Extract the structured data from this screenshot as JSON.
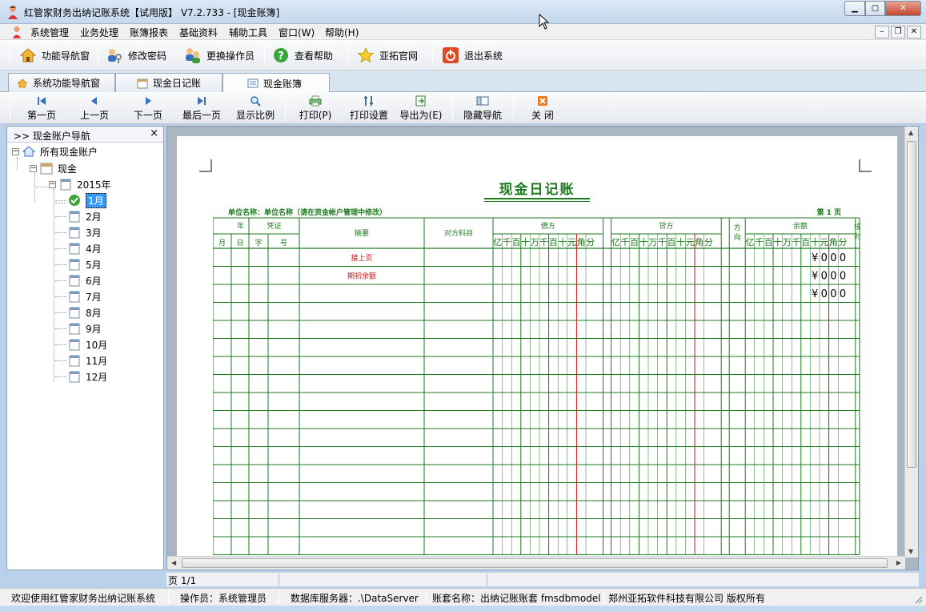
{
  "window": {
    "title": "红管家财务出纳记账系统【试用版】 V7.2.733 - [现金账簿]"
  },
  "menu": [
    "系统管理",
    "业务处理",
    "账簿报表",
    "基础资料",
    "辅助工具",
    "窗口(W)",
    "帮助(H)"
  ],
  "toolbar": {
    "nav": "功能导航窗",
    "password": "修改密码",
    "switch_user": "更换操作员",
    "help": "查看帮助",
    "website": "亚拓官网",
    "exit": "退出系统"
  },
  "tabs": [
    "系统功能导航窗",
    "现金日记账",
    "现金账簿"
  ],
  "report_toolbar": {
    "first": "第一页",
    "prev": "上一页",
    "next": "下一页",
    "last": "最后一页",
    "zoom": "显示比例",
    "print": "打印(P)",
    "print_setup": "打印设置",
    "export": "导出为(E)",
    "hide_nav": "隐藏导航",
    "close": "关 闭"
  },
  "nav_panel": {
    "title": ">> 现金账户导航",
    "close": "×",
    "root": "所有现金账户",
    "account": "现金",
    "year": "2015年",
    "months": [
      "1月",
      "2月",
      "3月",
      "4月",
      "5月",
      "6月",
      "7月",
      "8月",
      "9月",
      "10月",
      "11月",
      "12月"
    ],
    "selected_month": "1月"
  },
  "ledger": {
    "title": "现金日记账",
    "unit_label": "单位名称：单位名称（请在资金帐户管理中修改）",
    "page_label": "第  1  页",
    "headers": {
      "year": "年",
      "voucher": "凭证",
      "month": "月",
      "day": "日",
      "type": "字",
      "number": "号",
      "summary": "摘要",
      "counter_account": "对方科目",
      "debit": "借方",
      "credit": "贷方",
      "direction": "方向",
      "balance": "余额",
      "check": "核对"
    },
    "digit_units": [
      "亿",
      "千",
      "百",
      "十",
      "万",
      "千",
      "百",
      "十",
      "元",
      "角",
      "分"
    ],
    "rows": [
      {
        "summary": "接上页",
        "balance": "¥000"
      },
      {
        "summary": "期初余额",
        "balance": "¥000"
      },
      {
        "summary": "",
        "balance": "¥000"
      }
    ]
  },
  "status": {
    "page": "页 1/1",
    "welcome": "欢迎使用红管家财务出纳记账系统",
    "operator": "操作员：系统管理员",
    "db_server": "数据库服务器：.\\DataServer",
    "account_set": "账套名称：出纳记账账套 fmsdbmodel",
    "copyright": "郑州亚拓软件科技有限公司 版权所有"
  },
  "colors": {
    "ledger_green": "#1c7a1c",
    "ledger_red": "#d01010",
    "selection": "#3399ff"
  }
}
